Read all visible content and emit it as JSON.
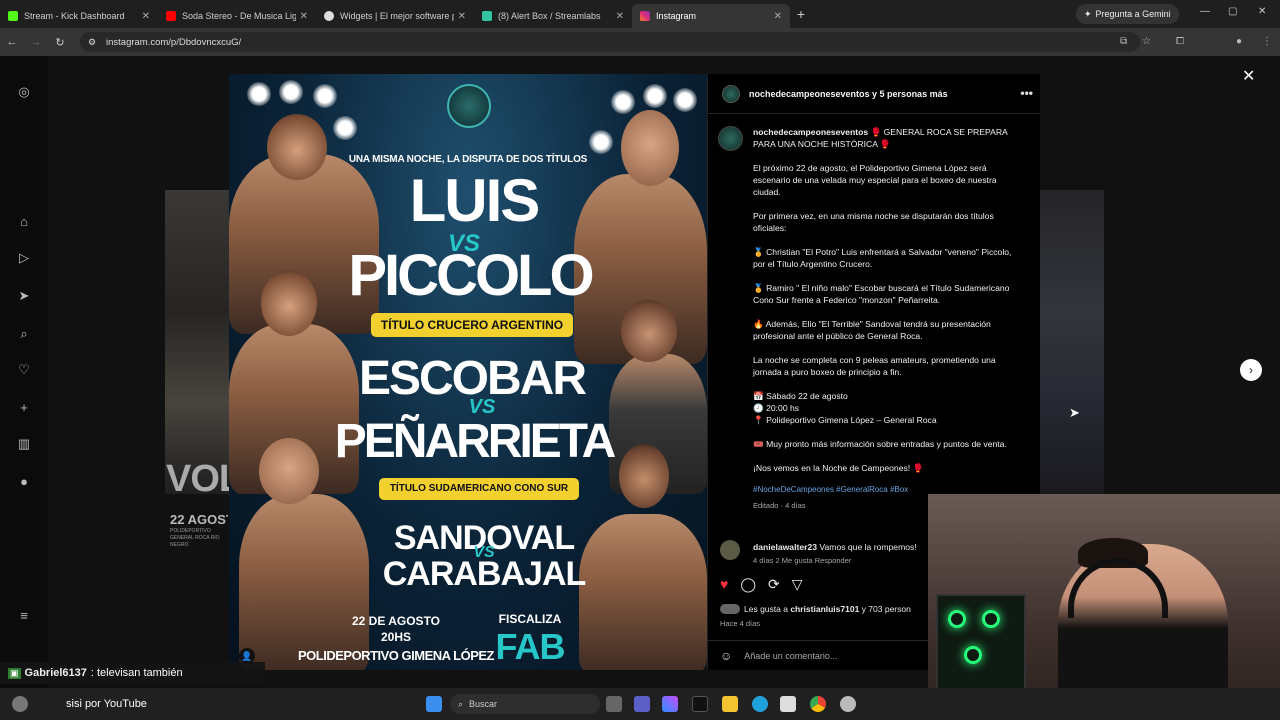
{
  "browser": {
    "tabs": [
      {
        "title": "Stream - Kick Dashboard",
        "color": "#53fc18"
      },
      {
        "title": "Soda Stereo - De Musica Ligera",
        "color": "#ff0000"
      },
      {
        "title": "Widgets | El mejor software pa",
        "color": "#ffffff"
      },
      {
        "title": "(8) Alert Box / Streamlabs",
        "color": "#31c3a2"
      },
      {
        "title": "Instagram",
        "color": "#e1306c"
      }
    ],
    "gemini_label": "Pregunta a Gemini",
    "url": "instagram.com/p/DbdovncxcuG/"
  },
  "poster": {
    "subtitle": "UNA MISMA NOCHE, LA DISPUTA DE DOS TÍTULOS",
    "fight1_a": "LUIS",
    "fight1_vs": "VS",
    "fight1_b": "PICCOLO",
    "title1": "TÍTULO CRUCERO ARGENTINO",
    "fight2_a": "ESCOBAR",
    "fight2_vs": "VS",
    "fight2_b": "PEÑARRIETA",
    "title2": "TÍTULO SUDAMERICANO CONO SUR",
    "fight3_a": "SANDOVAL",
    "fight3_vs": "VS",
    "fight3_b": "CARABAJAL",
    "date": "22 DE AGOSTO",
    "time": "20HS",
    "venue": "POLIDEPORTIVO GIMENA LÓPEZ",
    "fiscaliza": "FISCALIZA",
    "fab": "FAB"
  },
  "backdrop": {
    "left_text": "VOL",
    "left_small": "22 AGOSTO",
    "left_venue": "POLIDEPORTIVO GENERAL ROCA RIO NEGRO"
  },
  "post": {
    "header": "nochedecampeoneseventos y 5 personas más",
    "author": "nochedecampeoneseventos",
    "intro": "🥊 GENERAL ROCA SE PREPARA PARA UNA NOCHE HISTÓRICA 🥊",
    "p1": "El próximo 22 de agosto, el Polideportivo Gimena López será escenario de una velada muy especial para el boxeo de nuestra ciudad.",
    "p2": "Por primera vez, en una misma noche se disputarán dos títulos oficiales:",
    "p3": "🏅 Christian \"El Potro\" Luis enfrentará a Salvador \"veneno\" Piccolo, por el Título Argentino Crucero.",
    "p4": "🏅 Ramiro \" El niño malo\" Escobar buscará el Título Sudamericano Cono Sur frente a Federico \"monzon\" Peñarreita.",
    "p5": "🔥 Además, Elio \"El Terrible\" Sandoval tendrá su presentación profesional ante el público de General Roca.",
    "p6": "La noche se completa con 9 peleas amateurs, prometiendo una jornada a puro boxeo de principio a fin.",
    "d1": "📅 Sábado 22 de agosto",
    "d2": "🕗 20:00 hs",
    "d3": "📍 Polideportivo Gimena López – General Roca",
    "p7": "🎟️ Muy pronto más información sobre entradas y puntos de venta.",
    "p8": "¡Nos vemos en la Noche de Campeones! 🥊",
    "tags": "#NocheDeCampeones #GeneralRoca #Box",
    "edited": "Editado · 4 días",
    "comment_user": "danielawalter23",
    "comment_text": "Vamos que la rompemos!",
    "comment_meta": "4 días  2 Me gusta  Responder",
    "likes_prefix": "Les gusta a",
    "likes_user": "christianluis7101",
    "likes_suffix": "y 703 person",
    "posted": "Hace 4 días",
    "add_comment": "Añade un comentario..."
  },
  "chat": {
    "user1": "Gabriel6137",
    "msg1": ": televisan también",
    "msg2": "sisi por YouTube"
  },
  "taskbar": {
    "search": "Buscar"
  }
}
